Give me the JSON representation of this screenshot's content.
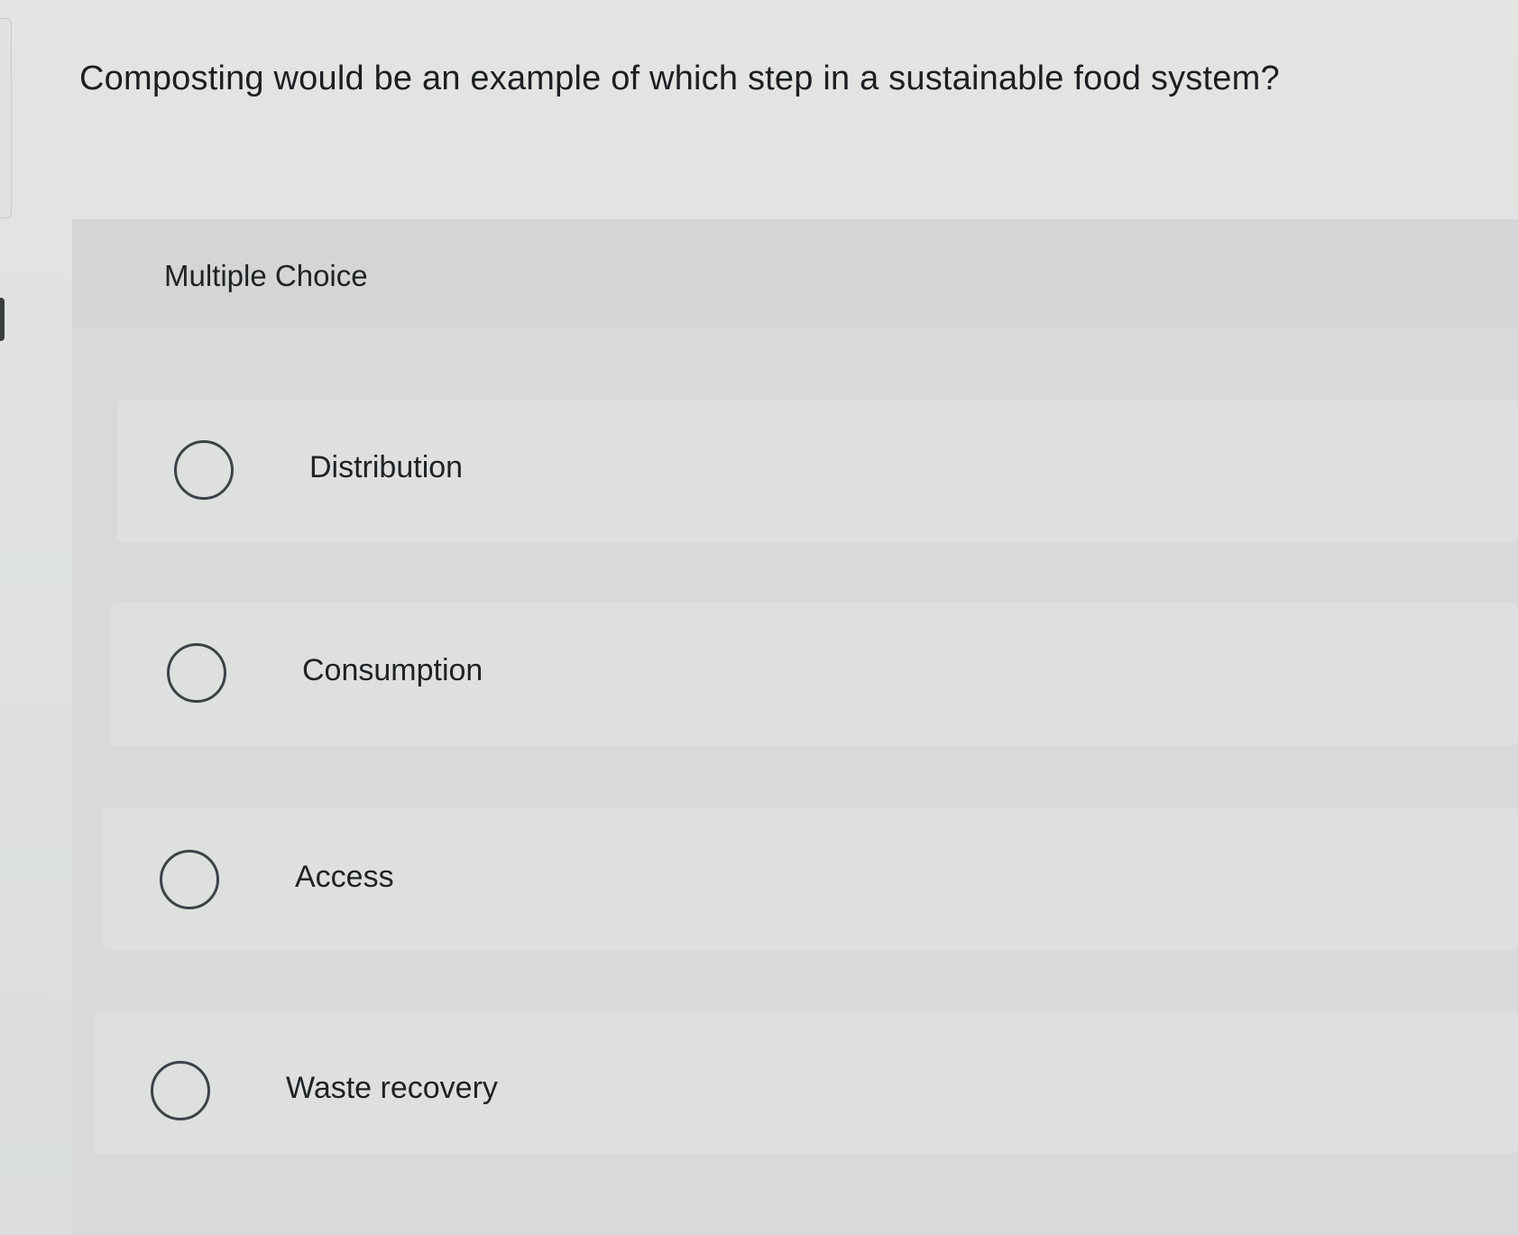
{
  "question": {
    "text": "Composting would be an example of which step in a sustainable food system?"
  },
  "choice_block": {
    "label": "Multiple Choice",
    "options": [
      {
        "label": "Distribution",
        "selected": false
      },
      {
        "label": "Consumption",
        "selected": false
      },
      {
        "label": "Access",
        "selected": false
      },
      {
        "label": "Waste recovery",
        "selected": false
      }
    ]
  }
}
